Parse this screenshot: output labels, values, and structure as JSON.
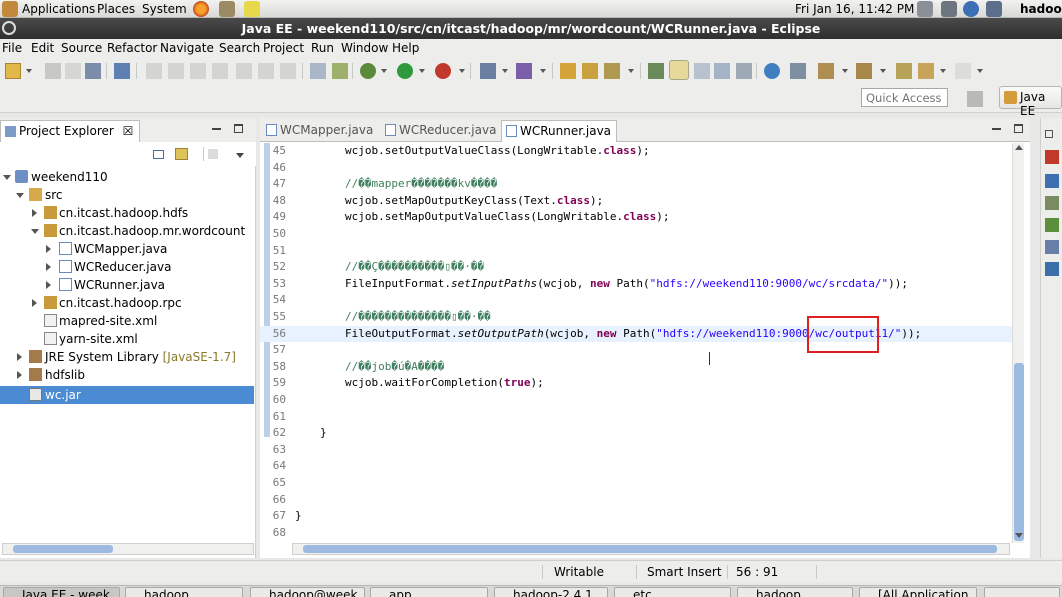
{
  "top_panel": {
    "menus": [
      "Applications",
      "Places",
      "System"
    ],
    "clock": "Fri Jan 16, 11:42 PM",
    "user": "hadoop"
  },
  "window": {
    "title": "Java EE - weekend110/src/cn/itcast/hadoop/mr/wordcount/WCRunner.java - Eclipse"
  },
  "menu_bar": [
    "File",
    "Edit",
    "Source",
    "Refactor",
    "Navigate",
    "Search",
    "Project",
    "Run",
    "Window",
    "Help"
  ],
  "toolbar": {
    "quick_access_placeholder": "Quick Access",
    "perspective_label": "Java EE"
  },
  "project_explorer": {
    "title": "Project Explorer",
    "close_glyph": "☒",
    "tree": [
      {
        "label": "weekend110",
        "expanded": true
      },
      {
        "label": "src",
        "expanded": true
      },
      {
        "label": "cn.itcast.hadoop.hdfs",
        "expanded": false
      },
      {
        "label": "cn.itcast.hadoop.mr.wordcount",
        "expanded": true
      },
      {
        "label": "WCMapper.java",
        "expanded": false
      },
      {
        "label": "WCReducer.java",
        "expanded": false
      },
      {
        "label": "WCRunner.java",
        "expanded": false
      },
      {
        "label": "cn.itcast.hadoop.rpc",
        "expanded": false
      },
      {
        "label": "mapred-site.xml"
      },
      {
        "label": "yarn-site.xml"
      },
      {
        "label": "JRE System Library",
        "suffix": "[JavaSE-1.7]",
        "expanded": false
      },
      {
        "label": "hdfslib",
        "expanded": false
      },
      {
        "label": "wc.jar",
        "selected": true
      }
    ]
  },
  "editor": {
    "tabs": [
      {
        "label": "WCMapper.java",
        "active": false
      },
      {
        "label": "WCReducer.java",
        "active": false
      },
      {
        "label": "WCRunner.java",
        "active": true
      }
    ],
    "tab_close_glyph": "☒",
    "current_line": 56,
    "lines": [
      {
        "n": "45",
        "code": "wcjob.setOutputValueClass(LongWritable.class);"
      },
      {
        "n": "46",
        "code": ""
      },
      {
        "n": "47",
        "code": "//��mapper�������kv����"
      },
      {
        "n": "48",
        "code": "wcjob.setMapOutputKeyClass(Text.class);"
      },
      {
        "n": "49",
        "code": "wcjob.setMapOutputValueClass(LongWritable.class);"
      },
      {
        "n": "50",
        "code": ""
      },
      {
        "n": "51",
        "code": ""
      },
      {
        "n": "52",
        "code": "//��Ç����������▯��·��"
      },
      {
        "n": "53",
        "code": "FileInputFormat.setInputPaths(wcjob, new Path(\"hdfs://weekend110:9000/wc/srcdata/\"));"
      },
      {
        "n": "54",
        "code": ""
      },
      {
        "n": "55",
        "code": "//��������������▯��·��"
      },
      {
        "n": "56",
        "code": "FileOutputFormat.setOutputPath(wcjob, new Path(\"hdfs://weekend110:9000/wc/output11/\"));"
      },
      {
        "n": "57",
        "code": ""
      },
      {
        "n": "58",
        "code": "//��job�ú�A����"
      },
      {
        "n": "59",
        "code": "wcjob.waitForCompletion(true);"
      },
      {
        "n": "60",
        "code": ""
      },
      {
        "n": "61",
        "code": ""
      },
      {
        "n": "62",
        "code": "}"
      },
      {
        "n": "63",
        "code": ""
      },
      {
        "n": "64",
        "code": ""
      },
      {
        "n": "65",
        "code": ""
      },
      {
        "n": "66",
        "code": ""
      },
      {
        "n": "67",
        "code": "}"
      },
      {
        "n": "68",
        "code": ""
      }
    ]
  },
  "status_bar": {
    "mode": "Writable",
    "insert": "Smart Insert",
    "position": "56 : 91"
  },
  "taskbar": [
    "Java EE - week...",
    "hadoop",
    "hadoop@week...",
    "app",
    "hadoop-2.4.1",
    "etc",
    "hadoop",
    "[All Application..."
  ],
  "colors": {
    "keyword": "#7f0055",
    "string": "#2a00ff",
    "comment": "#3f7f5f",
    "selection": "#4a8bd4",
    "highlight_box": "#e02020"
  }
}
